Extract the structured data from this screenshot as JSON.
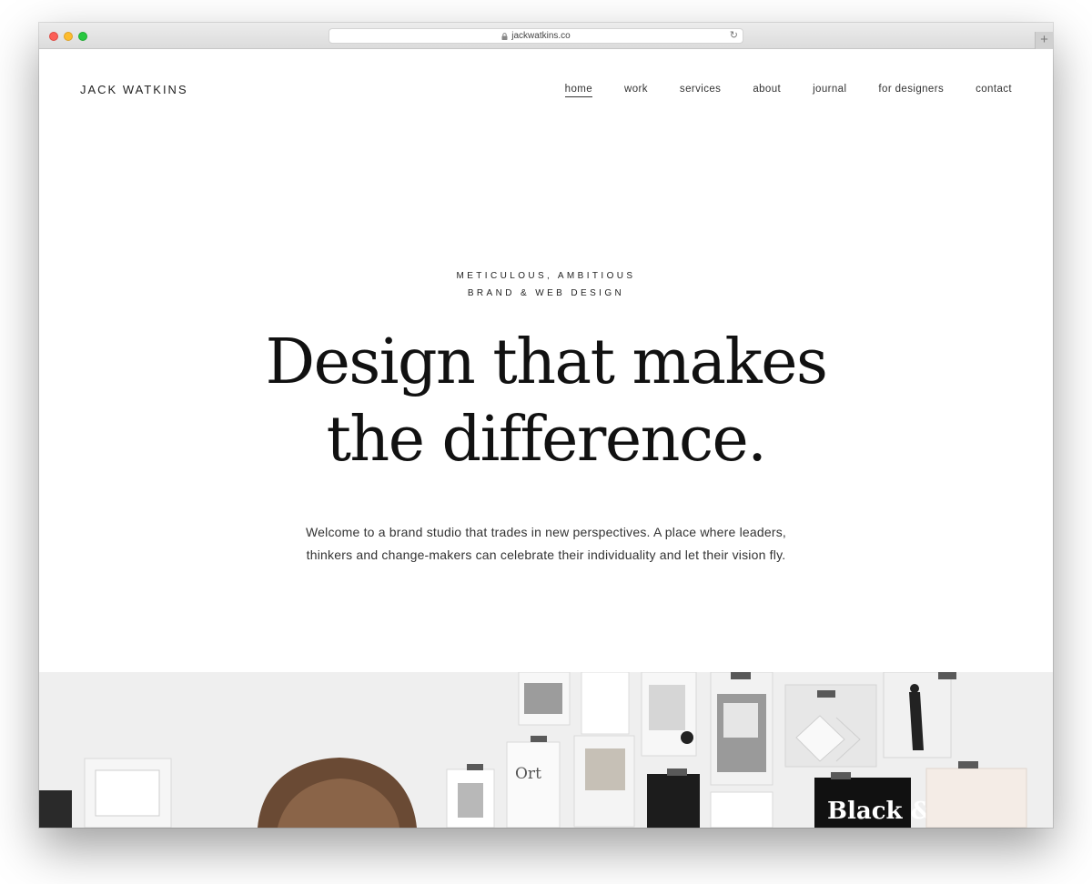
{
  "browser": {
    "url": "jackwatkins.co",
    "icons": {
      "lock": "lock-icon",
      "reload": "reload-icon",
      "new_tab": "plus-icon"
    }
  },
  "site": {
    "logo": "JACK WATKINS",
    "nav": [
      {
        "label": "home",
        "active": true
      },
      {
        "label": "work",
        "active": false
      },
      {
        "label": "services",
        "active": false
      },
      {
        "label": "about",
        "active": false
      },
      {
        "label": "journal",
        "active": false
      },
      {
        "label": "for designers",
        "active": false
      },
      {
        "label": "contact",
        "active": false
      }
    ]
  },
  "hero": {
    "eyebrow_line1": "METICULOUS, AMBITIOUS",
    "eyebrow_line2": "BRAND & WEB DESIGN",
    "headline_line1": "Design that makes",
    "headline_line2": "the difference.",
    "intro_line1": "Welcome to a brand studio that trades in new perspectives. A place where leaders,",
    "intro_line2": "thinkers and change-makers can celebrate their individuality and let their vision fly.",
    "photo_poster_text": "Black &"
  },
  "colors": {
    "text": "#111111",
    "background": "#ffffff",
    "photo_wall": "#efefef"
  }
}
